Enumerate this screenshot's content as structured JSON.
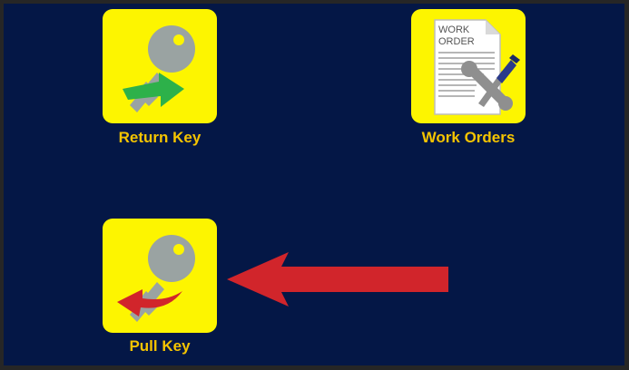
{
  "tiles": [
    {
      "label": "Return Key",
      "icon": "return-key-icon"
    },
    {
      "label": "Work Orders",
      "icon": "work-orders-icon"
    },
    {
      "label": "Pull Key",
      "icon": "pull-key-icon"
    }
  ],
  "work_order_doc": {
    "line1": "WORK",
    "line2": "ORDER"
  },
  "colors": {
    "background": "#041746",
    "tile": "#fdf500",
    "label": "#f5c400",
    "annotation_arrow": "#d1252b",
    "return_arrow": "#2db14a",
    "pull_arrow": "#d1252b",
    "key": "#9aa3a2"
  },
  "annotation": {
    "icon": "left-arrow-annotation-icon",
    "points_to": "Pull Key"
  }
}
